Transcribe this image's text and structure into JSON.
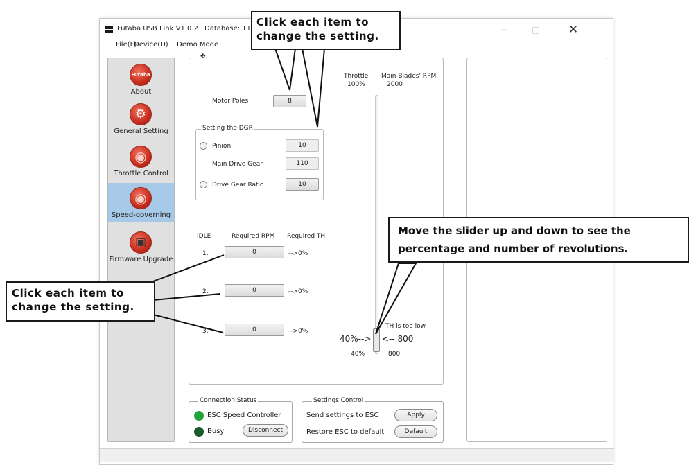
{
  "window": {
    "title": "Futaba USB Link V1.0.2",
    "database": "Database: 11",
    "controls": {
      "minimize": "–",
      "maximize": "□",
      "close": "✕"
    }
  },
  "menu": [
    "File(F)",
    "Device(D)",
    "Demo Mode"
  ],
  "sidebar": {
    "items": [
      {
        "label": "About",
        "icon": "futaba-logo-icon",
        "icon_text": "Futaba"
      },
      {
        "label": "General Setting",
        "icon": "gears-icon"
      },
      {
        "label": "Throttle Control",
        "icon": "throttle-dial-icon"
      },
      {
        "label": "Speed-governing",
        "icon": "speed-dial-icon",
        "selected": true
      },
      {
        "label": "Firmware Upgrade",
        "icon": "chip-icon"
      }
    ]
  },
  "main": {
    "group_legend": "✣",
    "motor_poles": {
      "label": "Motor Poles",
      "value": "8"
    },
    "dgr": {
      "legend": "Setting the DGR",
      "pinion": {
        "label": "Pinion",
        "value": "10"
      },
      "main_drive_gear": {
        "label": "Main Drive Gear",
        "value": "110"
      },
      "drive_gear_ratio": {
        "label": "Drive Gear Ratio",
        "value": "10"
      }
    },
    "throttle_header": {
      "label": "Throttle",
      "value": "100%"
    },
    "rpm_header": {
      "label": "Main Blades' RPM",
      "value": "2000"
    },
    "idle_table": {
      "headers": [
        "IDLE",
        "Required RPM",
        "Required TH"
      ],
      "rows": [
        {
          "index": "1.",
          "rpm": "0",
          "th": "-->0%"
        },
        {
          "index": "2.",
          "rpm": "0",
          "th": "-->0%"
        },
        {
          "index": "3.",
          "rpm": "0",
          "th": "-->0%"
        }
      ]
    },
    "slider": {
      "warning": "TH is too low",
      "throttle_readout": "40%-->",
      "rpm_readout": "<-- 800",
      "throttle_small": "40%",
      "rpm_small": "800",
      "level_percent": 40
    }
  },
  "connection": {
    "legend": "Connection Status",
    "esc": "ESC Speed Controller",
    "busy": "Busy",
    "disconnect": "Disconnect",
    "esc_color": "#22a33a",
    "busy_color": "#1c5a2a"
  },
  "settings": {
    "legend": "Settings Control",
    "send": "Send settings to ESC",
    "apply": "Apply",
    "restore": "Restore ESC to default",
    "default": "Default"
  },
  "callouts": {
    "top": [
      "Click each item to",
      "change the setting."
    ],
    "left": [
      "Click each item to",
      "change the setting."
    ],
    "right": [
      "Move the slider up and down to see the",
      "percentage and number of revolutions."
    ]
  }
}
